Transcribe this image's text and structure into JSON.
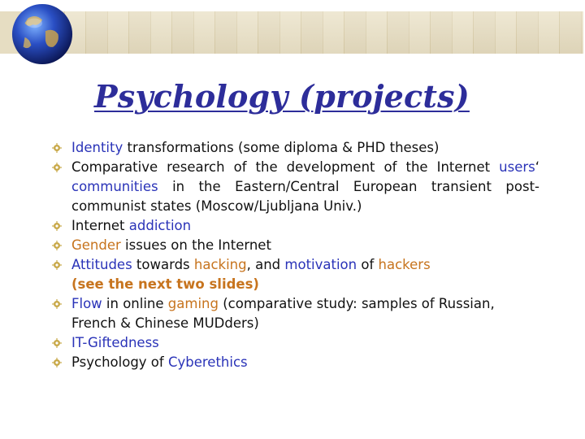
{
  "slide": {
    "title": "Psychology (projects)",
    "colors": {
      "title": "#2d2d9a",
      "highlight_blue": "#2a33b8",
      "highlight_orange": "#c7741e",
      "bullet": "#c9a94a"
    },
    "icons": {
      "logo": "globe-icon",
      "bullet": "sun-bullet-icon"
    },
    "items": [
      {
        "a": "Identity",
        "b": " transformations (some diploma & PHD theses)"
      },
      {
        "a": "Comparative research of the development of the Internet ",
        "b": "users",
        "c": "‘ ",
        "d": "communities",
        "e": " in the Eastern/Central European transient post-communist states (Moscow/Ljubljana Univ.)"
      },
      {
        "a": "Internet ",
        "b": "addiction"
      },
      {
        "a": "Gender",
        "b": " issues on the Internet"
      },
      {
        "a": "Attitudes",
        "b": " towards ",
        "c": "hacking",
        "d": ", and ",
        "e": "motivation",
        "f": " of ",
        "g": "hackers",
        "h": "(see the next two slides)"
      },
      {
        "a": "Flow",
        "b": " in online ",
        "c": "gaming",
        "d": " (comparative study: samples of Russian, French & Chinese MUDders)"
      },
      {
        "a": "IT-Giftedness"
      },
      {
        "a": "Psychology of ",
        "b": "Cyberethics"
      }
    ]
  }
}
